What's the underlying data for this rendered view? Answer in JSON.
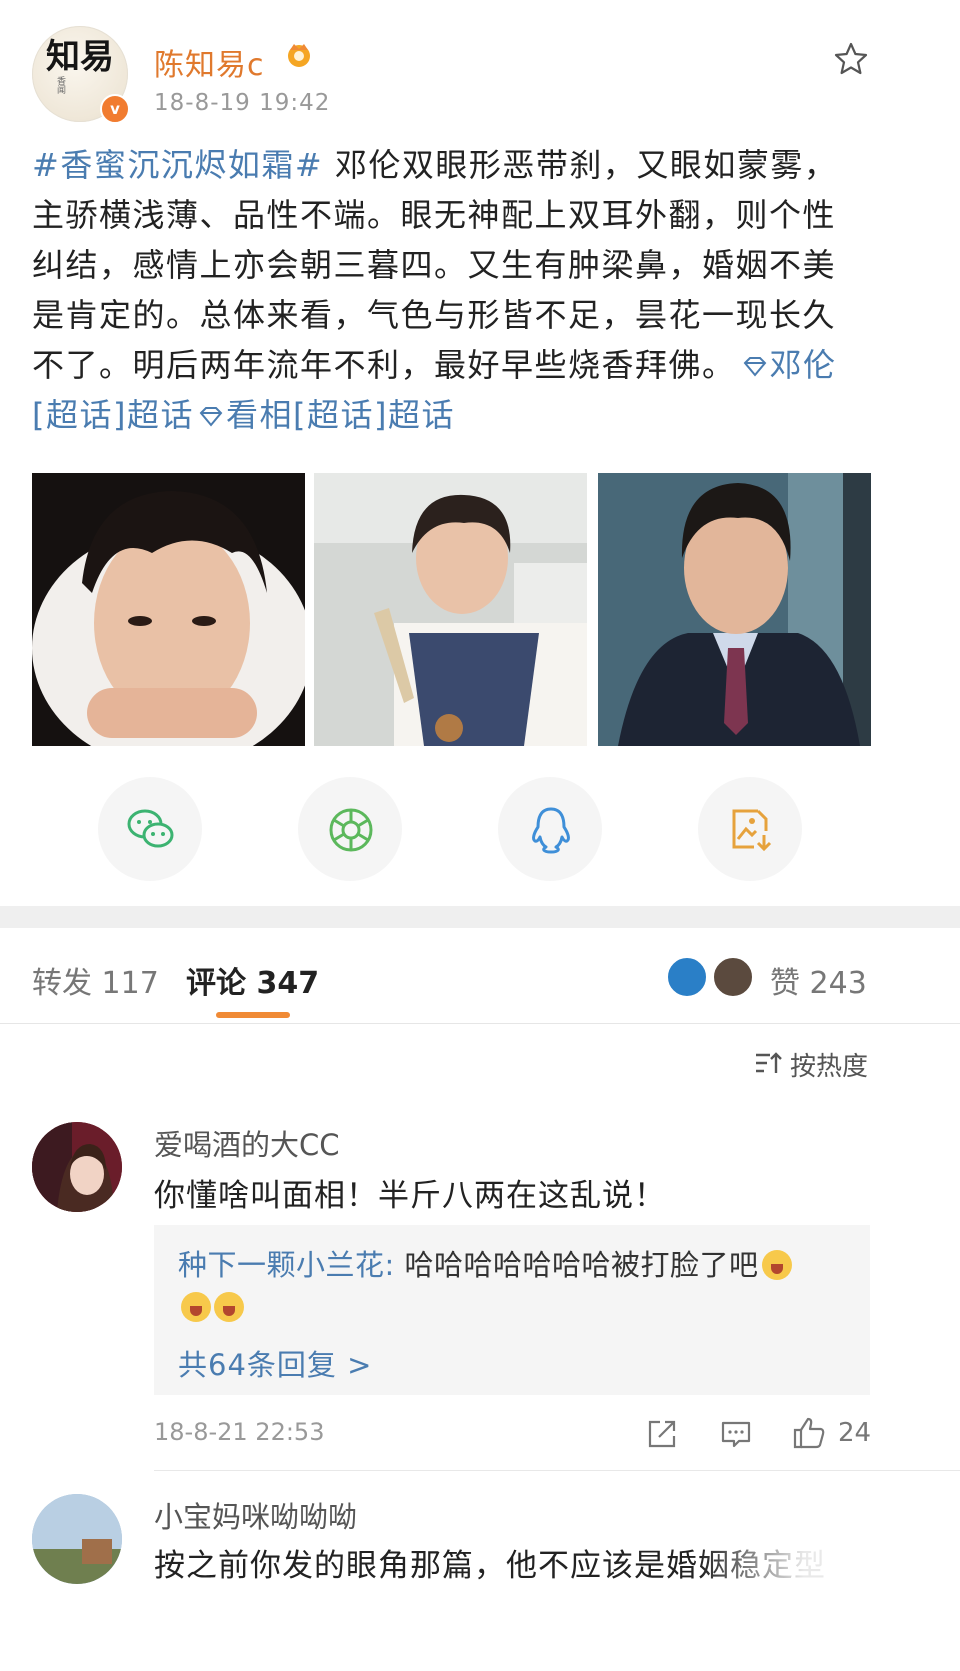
{
  "post": {
    "avatar_text": "知易",
    "avatar_seal": "香闻",
    "verified_badge": "v",
    "username": "陈知易c",
    "time": "18-8-19 19:42",
    "topic": "#香蜜沉沉烬如霜#",
    "body": " 邓伦双眼形恶带刹，又眼如蒙雾，主骄横浅薄、品性不端。眼无神配上双耳外翻，则个性纠结，感情上亦会朝三暮四。又生有肿梁鼻，婚姻不美是肯定的。总体来看，气色与形皆不足，昙花一现长久不了。明后两年流年不利，最好早些烧香拜佛。",
    "supertopic_1": "邓伦[超话]超话",
    "supertopic_2": "看相[超话]超话"
  },
  "share_icons": [
    "wechat-icon",
    "moments-icon",
    "qq-icon",
    "save-image-icon"
  ],
  "tabs": {
    "repost": "转发 117",
    "comment": "评论 347",
    "like": "赞 243"
  },
  "sort_label": "按热度",
  "comments": [
    {
      "name": "爱喝酒的大CC",
      "text": "你懂啥叫面相！半斤八两在这乱说！",
      "reply_user": "种下一颗小兰花:",
      "reply_text": " 哈哈哈哈哈哈哈被打脸了吧",
      "more_replies": "共64条回复 >",
      "time": "18-8-21 22:53",
      "likes": "24"
    },
    {
      "name": "小宝妈咪呦呦呦",
      "text": "按之前你发的眼角那篇，他不应该是婚姻稳定型"
    }
  ],
  "colors": {
    "accent": "#e0792d",
    "link": "#4a7cb0",
    "tab_indicator": "#f08a35"
  }
}
